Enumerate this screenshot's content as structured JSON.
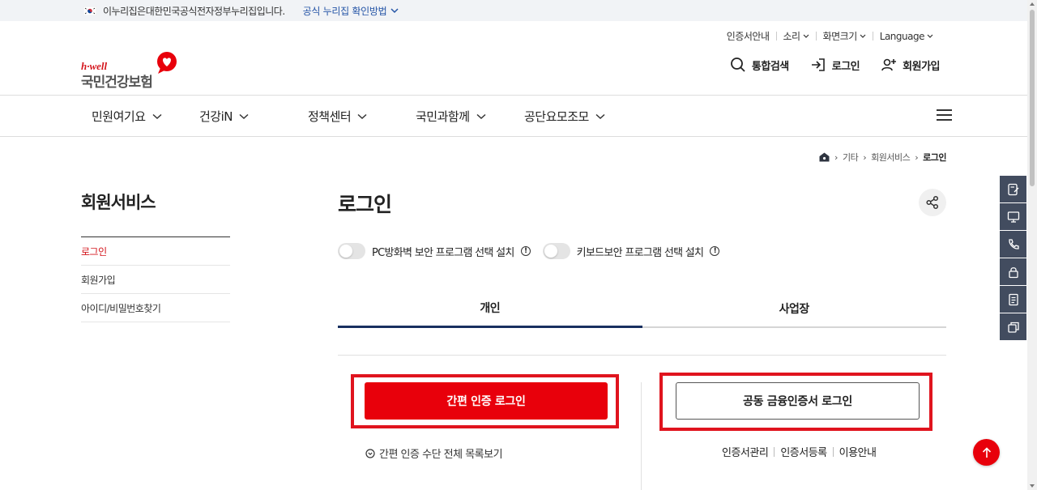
{
  "gov_bar": {
    "notice": "이누리집은대한민국공식전자정부누리집입니다.",
    "verify_link": "공식 누리집 확인방법"
  },
  "utility": {
    "items": [
      "인증서안내",
      "소리",
      "화면크기",
      "Language"
    ]
  },
  "logo": {
    "english": "h·well",
    "korean": "국민건강보험"
  },
  "header_actions": {
    "search": "통합검색",
    "login": "로그인",
    "signup": "회원가입"
  },
  "gnb": {
    "menus": [
      "민원여기요",
      "건강iN",
      "정책센터",
      "국민과함께",
      "공단요모조모"
    ]
  },
  "breadcrumb": {
    "items": [
      "기타",
      "회원서비스",
      "로그인"
    ]
  },
  "sidebar": {
    "title": "회원서비스",
    "items": [
      {
        "label": "로그인",
        "active": true
      },
      {
        "label": "회원가입",
        "active": false
      },
      {
        "label": "아이디/비밀번호찾기",
        "active": false
      }
    ]
  },
  "content": {
    "title": "로그인",
    "toggles": [
      {
        "label": "PC방화벽 보안 프로그램 선택 설치",
        "on": false
      },
      {
        "label": "키보드보안 프로그램 선택 설치",
        "on": false
      }
    ],
    "tabs": [
      {
        "label": "개인",
        "active": true
      },
      {
        "label": "사업장",
        "active": false
      }
    ],
    "simple_login_button": "간편 인증 로그인",
    "simple_login_list": "간편 인증 수단 전체 목록보기",
    "cert_login_button": "공동 금융인증서 로그인",
    "cert_links": [
      "인증서관리",
      "인증서등록",
      "이용안내"
    ]
  },
  "quick_menu": {
    "icons": [
      "document-edit-icon",
      "monitor-icon",
      "phone-icon",
      "lock-icon",
      "document-icon",
      "copy-icon"
    ]
  },
  "colors": {
    "brand_red": "#e8000b",
    "highlight_red": "#e0141e",
    "tab_active": "#183060",
    "quick_menu_bg": "#424c5f"
  }
}
